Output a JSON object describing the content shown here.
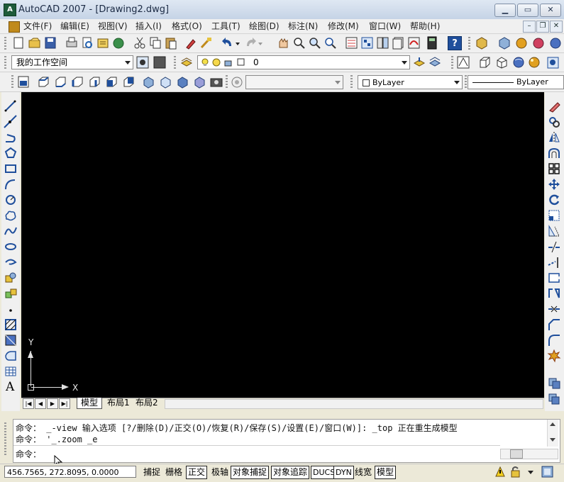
{
  "window": {
    "title": "AutoCAD 2007 - [Drawing2.dwg]",
    "min_glyph": "▁",
    "max_glyph": "▭",
    "close_glyph": "✕",
    "app_icon_glyph": "A"
  },
  "menubar": {
    "items": [
      "文件(F)",
      "编辑(E)",
      "视图(V)",
      "插入(I)",
      "格式(O)",
      "工具(T)",
      "绘图(D)",
      "标注(N)",
      "修改(M)",
      "窗口(W)",
      "帮助(H)"
    ],
    "mdi_min": "–",
    "mdi_restore": "❐",
    "mdi_close": "✕"
  },
  "workspaces": {
    "current": "我的工作空间"
  },
  "layers": {
    "current_layer": "0"
  },
  "properties": {
    "color": "ByLayer",
    "linetype": "ByLayer"
  },
  "layout_tabs": {
    "tabs": [
      "模型",
      "布局1",
      "布局2"
    ],
    "nav": [
      "|◀",
      "◀",
      "▶",
      "▶|"
    ]
  },
  "canvas": {
    "ucs_x_label": "X",
    "ucs_y_label": "Y",
    "background": "#000000"
  },
  "command_window": {
    "history": [
      "命令： _-view 输入选项 [?/删除(D)/正交(O)/恢复(R)/保存(S)/设置(E)/窗口(W)]: _top 正在重生成模型",
      "命令： '_.zoom _e"
    ],
    "prompt": "命令："
  },
  "statusbar": {
    "coordinates": "456.7565, 272.8095, 0.0000",
    "toggles": [
      {
        "label": "捕捉",
        "on": false
      },
      {
        "label": "栅格",
        "on": false
      },
      {
        "label": "正交",
        "on": true
      },
      {
        "label": "极轴",
        "on": false
      },
      {
        "label": "对象捕捉",
        "on": true
      },
      {
        "label": "对象追踪",
        "on": true
      },
      {
        "label": "DUCS",
        "on": true
      },
      {
        "label": "DYN",
        "on": true
      },
      {
        "label": "线宽",
        "on": false
      },
      {
        "label": "模型",
        "on": true
      }
    ]
  },
  "icons": {
    "toolbar_standard": [
      "new-icon",
      "open-icon",
      "save-icon",
      "plot-icon",
      "plot-preview-icon",
      "publish-icon",
      "3d-dwf-icon",
      "cut-icon",
      "copy-icon",
      "paste-icon",
      "match-properties-icon",
      "block-editor-icon",
      "undo-icon",
      "redo-icon",
      "pan-icon",
      "zoom-realtime-icon",
      "zoom-window-icon",
      "zoom-previous-icon",
      "properties-icon",
      "design-center-icon",
      "tool-palettes-icon",
      "sheet-set-icon",
      "markup-icon",
      "calculator-icon",
      "help-icon"
    ],
    "toolbar_visual": [
      "hide-icon",
      "3d-wireframe-icon",
      "realistic-icon",
      "conceptual-icon",
      "sphere-icon",
      "visual-styles-icon"
    ],
    "left_draw": [
      "line-icon",
      "construction-line-icon",
      "polyline-icon",
      "polygon-icon",
      "rectangle-icon",
      "arc-icon",
      "circle-icon",
      "revision-cloud-icon",
      "spline-icon",
      "ellipse-icon",
      "ellipse-arc-icon",
      "insert-block-icon",
      "make-block-icon",
      "point-icon",
      "hatch-icon",
      "gradient-icon",
      "region-icon",
      "table-icon",
      "multiline-text-icon"
    ],
    "right_modify": [
      "erase-icon",
      "copy-object-icon",
      "mirror-icon",
      "offset-icon",
      "array-icon",
      "move-icon",
      "rotate-icon",
      "scale-icon",
      "stretch-icon",
      "trim-icon",
      "extend-icon",
      "break-at-point-icon",
      "break-icon",
      "join-icon",
      "chamfer-icon",
      "fillet-icon",
      "explode-icon"
    ]
  },
  "colors": {
    "accent_blue": "#1f4f9c",
    "status_on_border": "#222222"
  }
}
